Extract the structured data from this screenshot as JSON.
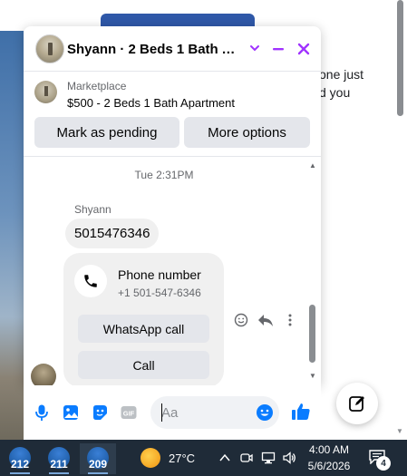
{
  "background": {
    "text_line_1": "one just",
    "text_line_2": "d you"
  },
  "chat": {
    "title": "Shyann · 2 Beds 1 Bath Ap...",
    "marketplace": {
      "label": "Marketplace",
      "listing": "$500 - 2 Beds 1 Bath Apartment",
      "pending_button": "Mark as pending",
      "more_button": "More options"
    },
    "messages": {
      "timestamp": "Tue 2:31PM",
      "sender_name": "Shyann",
      "phone_text": "5015476346",
      "card": {
        "title": "Phone number",
        "number": "+1 501-547-6346",
        "whatsapp_button": "WhatsApp call",
        "call_button": "Call"
      }
    },
    "composer": {
      "placeholder": "Aa"
    }
  },
  "taskbar": {
    "apps": [
      {
        "label": "212"
      },
      {
        "label": "211"
      },
      {
        "label": "209"
      }
    ],
    "weather_temp": "27°C",
    "time": "4:00 AM",
    "date": "5/6/2026",
    "notification_count": "4"
  },
  "colors": {
    "accent_purple": "#a033ff",
    "messenger_blue": "#0a7cff",
    "taskbar_bg": "#1f2b38"
  },
  "icons": [
    "chevron-down-icon",
    "minimize-icon",
    "close-icon",
    "phone-icon",
    "emoji-icon",
    "reply-icon",
    "more-icon",
    "microphone-icon",
    "image-icon",
    "sticker-icon",
    "gif-icon",
    "emoji-picker-icon",
    "like-icon",
    "edit-icon",
    "weather-icon",
    "chevron-up-icon",
    "notification-icon"
  ]
}
